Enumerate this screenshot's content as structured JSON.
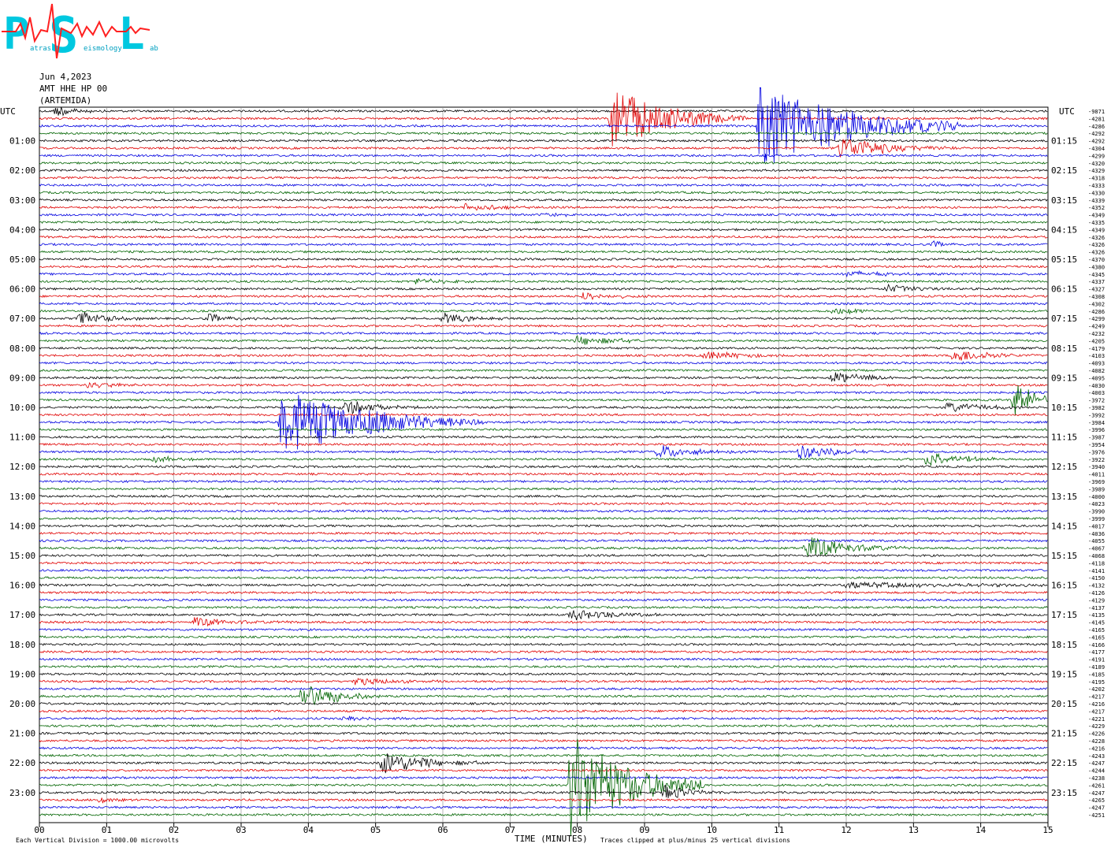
{
  "logo": {
    "letters": [
      "P",
      "S",
      "L"
    ],
    "small_words": [
      "atras",
      "eismology",
      "ab"
    ],
    "colors": {
      "letters": "#00c8e0",
      "trace": "#ff2020"
    }
  },
  "header": {
    "date": "Jun 4,2023",
    "station": "AMT HHE HP 00",
    "location": "(ARTEMIDA)"
  },
  "left_axis_title": "UTC",
  "right_axis_title": "UTC",
  "footer": {
    "x_title": "TIME (MINUTES)",
    "scale_note": "Each Vertical Division = 1000.00 microvolts",
    "clip_note": "Traces clipped at plus/minus 25 vertical divisions"
  },
  "chart_data": {
    "type": "line",
    "x_ticks": [
      "00",
      "01",
      "02",
      "03",
      "04",
      "05",
      "06",
      "07",
      "08",
      "09",
      "10",
      "11",
      "12",
      "13",
      "14",
      "15"
    ],
    "xlim": [
      0,
      15
    ],
    "grid": "vertical lines each minute",
    "row_minutes": 15,
    "row_count": 96,
    "series_colors": [
      "#000000",
      "#e00000",
      "#0000e0",
      "#006400"
    ],
    "left_hour_labels": [
      "UTC",
      "01:00",
      "02:00",
      "03:00",
      "04:00",
      "05:00",
      "06:00",
      "07:00",
      "08:00",
      "09:00",
      "10:00",
      "11:00",
      "12:00",
      "13:00",
      "14:00",
      "15:00",
      "16:00",
      "17:00",
      "18:00",
      "19:00",
      "20:00",
      "21:00",
      "22:00",
      "23:00"
    ],
    "right_hour_labels": [
      "UTC",
      "01:15",
      "02:15",
      "03:15",
      "04:15",
      "05:15",
      "06:15",
      "07:15",
      "08:15",
      "09:15",
      "10:15",
      "11:15",
      "12:15",
      "13:15",
      "14:15",
      "15:15",
      "16:15",
      "17:15",
      "18:15",
      "19:15",
      "20:15",
      "21:15",
      "22:15",
      "23:15"
    ],
    "row_offsets": [
      -9871,
      -4281,
      -4286,
      -4292,
      -4292,
      -4304,
      -4299,
      -4320,
      -4329,
      -4318,
      -4333,
      -4330,
      -4339,
      -4352,
      -4349,
      -4335,
      -4349,
      -4326,
      -4326,
      -4326,
      -4370,
      -4380,
      -4345,
      -4337,
      -4327,
      -4308,
      -4302,
      -4286,
      -4299,
      -4249,
      -4232,
      -4205,
      -4179,
      -4103,
      -4093,
      -4082,
      -4095,
      -4030,
      -4003,
      -3972,
      -3982,
      -3992,
      -3984,
      -3996,
      -3987,
      -3954,
      -3976,
      -3922,
      -3940,
      -4011,
      -3969,
      -3989,
      -4000,
      -4023,
      -3990,
      -3999,
      -4017,
      -4036,
      -4055,
      -4067,
      -4068,
      -4118,
      -4141,
      -4150,
      -4132,
      -4126,
      -4129,
      -4137,
      -4135,
      -4145,
      -4165,
      -4165,
      -4166,
      -4177,
      -4191,
      -4189,
      -4185,
      -4195,
      -4202,
      -4217,
      -4216,
      -4217,
      -4221,
      -4229,
      -4226,
      -4228,
      -4216,
      -4243,
      -4247,
      -4244,
      -4238,
      -4261,
      -4247,
      -4265,
      -4247,
      -4251
    ],
    "events": [
      {
        "row": 0,
        "minute": 0.25,
        "amplitude": 8,
        "width": 0.3
      },
      {
        "row": 1,
        "minute": 8.5,
        "amplitude": 42,
        "width": 0.8
      },
      {
        "row": 2,
        "minute": 10.7,
        "amplitude": 60,
        "width": 1.2
      },
      {
        "row": 5,
        "minute": 11.9,
        "amplitude": 15,
        "width": 0.7
      },
      {
        "row": 13,
        "minute": 6.3,
        "amplitude": 6,
        "width": 0.5
      },
      {
        "row": 14,
        "minute": 7.5,
        "amplitude": 3,
        "width": 0.4
      },
      {
        "row": 18,
        "minute": 13.3,
        "amplitude": 4,
        "width": 0.3
      },
      {
        "row": 22,
        "minute": 12.0,
        "amplitude": 4,
        "width": 0.6
      },
      {
        "row": 23,
        "minute": 5.6,
        "amplitude": 4,
        "width": 0.4
      },
      {
        "row": 24,
        "minute": 12.6,
        "amplitude": 6,
        "width": 0.4
      },
      {
        "row": 25,
        "minute": 8.1,
        "amplitude": 6,
        "width": 0.4
      },
      {
        "row": 28,
        "minute": 0.6,
        "amplitude": 9,
        "width": 0.4
      },
      {
        "row": 28,
        "minute": 2.5,
        "amplitude": 6,
        "width": 0.4
      },
      {
        "row": 28,
        "minute": 6.0,
        "amplitude": 7,
        "width": 0.4
      },
      {
        "row": 27,
        "minute": 11.8,
        "amplitude": 5,
        "width": 0.5
      },
      {
        "row": 31,
        "minute": 8.0,
        "amplitude": 7,
        "width": 0.5
      },
      {
        "row": 33,
        "minute": 9.9,
        "amplitude": 7,
        "width": 0.5
      },
      {
        "row": 33,
        "minute": 13.6,
        "amplitude": 9,
        "width": 0.5
      },
      {
        "row": 36,
        "minute": 11.8,
        "amplitude": 8,
        "width": 0.5
      },
      {
        "row": 37,
        "minute": 0.7,
        "amplitude": 4,
        "width": 0.5
      },
      {
        "row": 39,
        "minute": 14.5,
        "amplitude": 25,
        "width": 0.3
      },
      {
        "row": 40,
        "minute": 4.5,
        "amplitude": 10,
        "width": 0.5
      },
      {
        "row": 40,
        "minute": 13.5,
        "amplitude": 6,
        "width": 0.6
      },
      {
        "row": 42,
        "minute": 3.6,
        "amplitude": 45,
        "width": 1.2
      },
      {
        "row": 46,
        "minute": 9.2,
        "amplitude": 9,
        "width": 0.5
      },
      {
        "row": 46,
        "minute": 11.3,
        "amplitude": 10,
        "width": 0.5
      },
      {
        "row": 47,
        "minute": 13.2,
        "amplitude": 10,
        "width": 0.5
      },
      {
        "row": 47,
        "minute": 1.7,
        "amplitude": 5,
        "width": 0.3
      },
      {
        "row": 59,
        "minute": 11.4,
        "amplitude": 16,
        "width": 0.6
      },
      {
        "row": 64,
        "minute": 12.0,
        "amplitude": 4,
        "width": 1.8
      },
      {
        "row": 68,
        "minute": 7.9,
        "amplitude": 7,
        "width": 0.7
      },
      {
        "row": 69,
        "minute": 2.3,
        "amplitude": 6,
        "width": 0.6
      },
      {
        "row": 77,
        "minute": 4.7,
        "amplitude": 6,
        "width": 0.5
      },
      {
        "row": 79,
        "minute": 3.9,
        "amplitude": 18,
        "width": 0.5
      },
      {
        "row": 82,
        "minute": 4.5,
        "amplitude": 4,
        "width": 0.4
      },
      {
        "row": 88,
        "minute": 5.1,
        "amplitude": 16,
        "width": 0.6
      },
      {
        "row": 91,
        "minute": 7.9,
        "amplitude": 70,
        "width": 0.8
      },
      {
        "row": 92,
        "minute": 9.3,
        "amplitude": 10,
        "width": 0.4
      },
      {
        "row": 93,
        "minute": 0.9,
        "amplitude": 4,
        "width": 0.2
      }
    ]
  }
}
